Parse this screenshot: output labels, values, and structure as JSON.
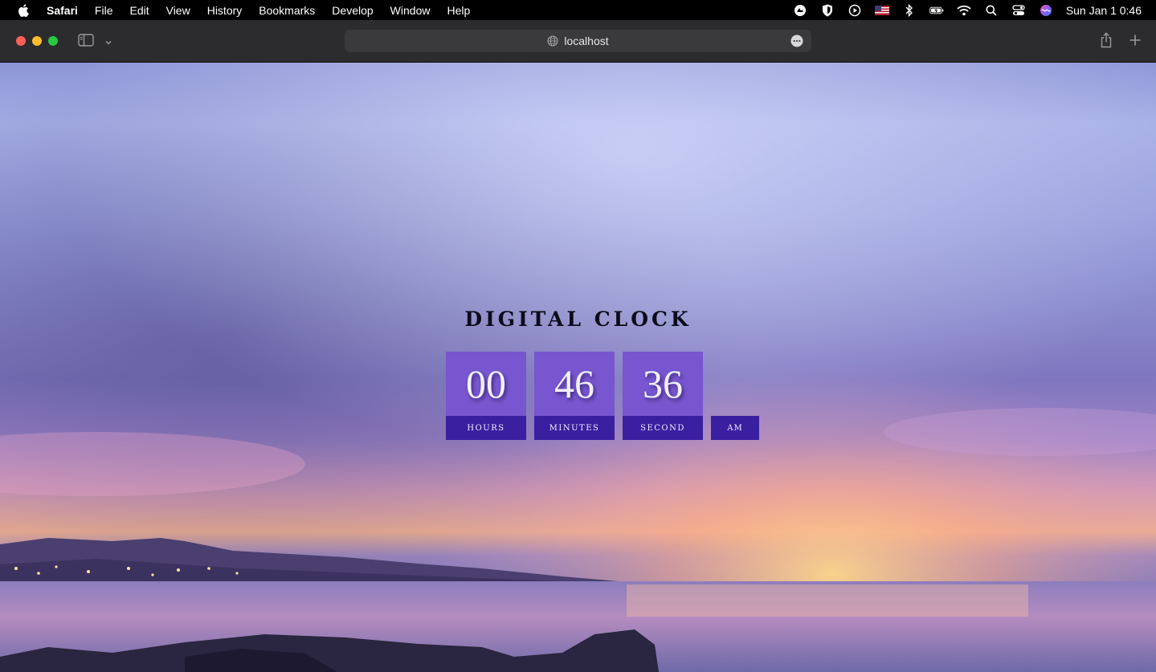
{
  "menubar": {
    "app_name": "Safari",
    "items": [
      "File",
      "Edit",
      "View",
      "History",
      "Bookmarks",
      "Develop",
      "Window",
      "Help"
    ],
    "clock": "Sun Jan 1  0:46"
  },
  "browser": {
    "url": "localhost"
  },
  "page": {
    "title": "DIGITAL CLOCK",
    "hours": "00",
    "minutes": "46",
    "seconds": "36",
    "hours_label": "HOURS",
    "minutes_label": "MINUTES",
    "seconds_label": "SECOND",
    "period": "AM"
  },
  "colors": {
    "tile_top": "#7756cf",
    "tile_label": "#3a1fa0"
  }
}
